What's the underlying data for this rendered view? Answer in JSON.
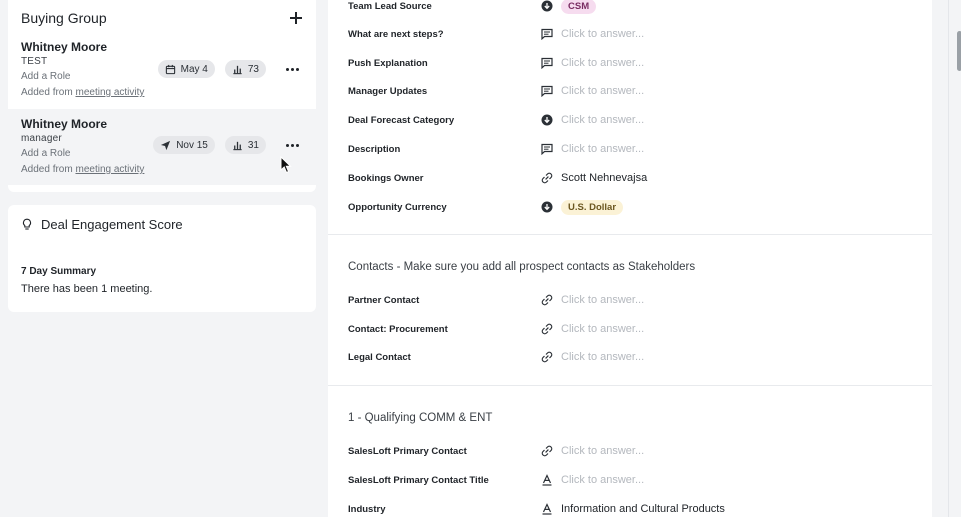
{
  "buying_group": {
    "title": "Buying Group",
    "contacts": [
      {
        "name": "Whitney Moore",
        "title": "TEST",
        "role_placeholder": "Add a Role",
        "added_prefix": "Added from",
        "added_link": "meeting activity",
        "chip_date": "May 4",
        "chip_date_icon": "calendar-icon",
        "chip_score": "73"
      },
      {
        "name": "Whitney Moore",
        "title": "manager",
        "role_placeholder": "Add a Role",
        "added_prefix": "Added from",
        "added_link": "meeting activity",
        "chip_date": "Nov 15",
        "chip_date_icon": "send-icon",
        "chip_score": "31"
      }
    ]
  },
  "engagement": {
    "title": "Deal Engagement Score",
    "summary_label": "7 Day Summary",
    "summary_text": "There has been 1 meeting."
  },
  "fields_top": [
    {
      "label": "Team Lead Source",
      "icon": "dropdown-icon",
      "value": "CSM",
      "kind": "tag-pink"
    },
    {
      "label": "What are next steps?",
      "icon": "comment-icon",
      "value": "Click to answer...",
      "kind": "placeholder"
    },
    {
      "label": "Push Explanation",
      "icon": "comment-icon",
      "value": "Click to answer...",
      "kind": "placeholder"
    },
    {
      "label": "Manager Updates",
      "icon": "comment-icon",
      "value": "Click to answer...",
      "kind": "placeholder"
    },
    {
      "label": "Deal Forecast Category",
      "icon": "dropdown-icon",
      "value": "Click to answer...",
      "kind": "placeholder"
    },
    {
      "label": "Description",
      "icon": "comment-icon",
      "value": "Click to answer...",
      "kind": "placeholder"
    },
    {
      "label": "Bookings Owner",
      "icon": "link-icon",
      "value": "Scott Nehnevajsa",
      "kind": "text"
    },
    {
      "label": "Opportunity Currency",
      "icon": "dropdown-icon",
      "value": "U.S. Dollar",
      "kind": "tag-yellow"
    }
  ],
  "contacts_section": {
    "title": "Contacts - Make sure you add all prospect contacts as Stakeholders",
    "fields": [
      {
        "label": "Partner Contact",
        "icon": "link-icon",
        "value": "Click to answer..."
      },
      {
        "label": "Contact: Procurement",
        "icon": "link-icon",
        "value": "Click to answer..."
      },
      {
        "label": "Legal Contact",
        "icon": "link-icon",
        "value": "Click to answer..."
      }
    ]
  },
  "qualifying_section": {
    "title": "1 - Qualifying COMM & ENT",
    "fields": [
      {
        "label": "SalesLoft Primary Contact",
        "icon": "link-icon",
        "value": "Click to answer...",
        "kind": "placeholder"
      },
      {
        "label": "SalesLoft Primary Contact Title",
        "icon": "text-icon",
        "value": "Click to answer...",
        "kind": "placeholder"
      },
      {
        "label": "Industry",
        "icon": "text-icon",
        "value": "Information and Cultural Products",
        "kind": "text"
      }
    ]
  },
  "colors": {
    "page_bg": "#f3f4f6",
    "csm_tag_bg": "#f6dcef",
    "usd_tag_bg": "#fbf2d6",
    "placeholder": "#b4b8be"
  }
}
